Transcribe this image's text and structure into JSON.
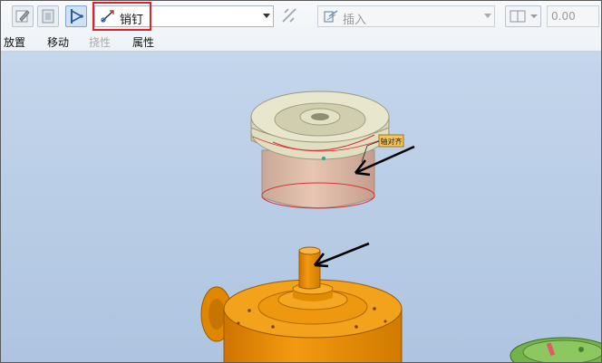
{
  "toolbar": {
    "constraint_type": {
      "selected": "销钉",
      "icon": "pin-constraint-icon"
    },
    "offset_type": {
      "selected": "插入",
      "icon": "insert-icon"
    },
    "offset_value": {
      "value": "0.00"
    }
  },
  "menu": {
    "items": [
      "放置",
      "移动",
      "挠性",
      "属性"
    ],
    "disabled": [
      "挠性"
    ]
  },
  "viewport": {
    "annotation_label": "轴对齐",
    "colors": {
      "background": "#b9cde6",
      "upper_part": "#d9b7a4",
      "lower_part": "#e98a00",
      "highlight": "#e0232a",
      "arrow": "#000000"
    }
  }
}
